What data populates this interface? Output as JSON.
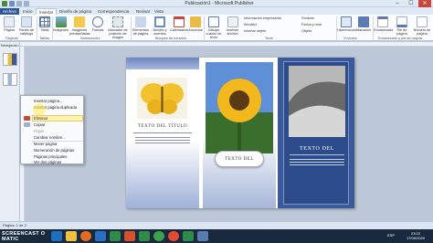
{
  "window": {
    "title": "Publicación1 - Microsoft Publisher",
    "minimize": "–",
    "maximize": "☐",
    "close": "✕"
  },
  "tabs": [
    "Archivo",
    "Inicio",
    "Insertar",
    "Diseño de página",
    "Correspondencia",
    "Revisar",
    "Vista"
  ],
  "ribbon": {
    "buttons": [
      {
        "label": "Página"
      },
      {
        "label": "Partes de catálogo"
      },
      {
        "label": "Tabla"
      },
      {
        "label": "Imágenes"
      },
      {
        "label": "Imágenes prediseñadas"
      },
      {
        "label": "Formas"
      },
      {
        "label": "Marcador de posición de imagen"
      },
      {
        "label": "Elementos de página"
      },
      {
        "label": "Bordes y acentos"
      },
      {
        "label": "Calendarios"
      },
      {
        "label": "Anuncios"
      },
      {
        "label": "Dibujar cuadro de texto"
      },
      {
        "label": "Insertar archivo"
      },
      {
        "label": "Hipervínculo"
      },
      {
        "label": "Marcador"
      },
      {
        "label": "Encabezado"
      },
      {
        "label": "Pie de página"
      },
      {
        "label": "Número de página"
      }
    ],
    "small": [
      "Información empresarial",
      "WordArt",
      "Insertar objeto",
      "Símbolo",
      "Fecha y hora",
      "Objeto"
    ],
    "groups": [
      "Páginas",
      "Tablas",
      "Ilustraciones",
      "Bloques de creación",
      "Texto",
      "Vínculos",
      "Encabezado y pie de página"
    ]
  },
  "pane": {
    "title": "Navegación de página"
  },
  "context_menu": {
    "items": [
      {
        "label": "Insertar página...",
        "enabled": true
      },
      {
        "label": "Insertar página duplicada",
        "enabled": true
      },
      {
        "label": "Eliminar",
        "enabled": true
      },
      {
        "label": "Copiar",
        "enabled": true
      },
      {
        "label": "Pegar",
        "enabled": false
      },
      {
        "label": "Cambiar nombre...",
        "enabled": true
      },
      {
        "label": "Mover página",
        "enabled": true
      },
      {
        "label": "Numeración de páginas",
        "enabled": true
      },
      {
        "label": "Páginas principales",
        "enabled": true
      },
      {
        "label": "Ver dos páginas",
        "enabled": true
      }
    ]
  },
  "document": {
    "panel1_title": "TEXTO DEL TÍTULO",
    "panel2_label": "TEXTO DEL",
    "panel3_title": "TEXTO DEL"
  },
  "statusbar": {
    "left": "Página: 1 de 2"
  },
  "taskbar": {
    "watermark": "SCREENCAST O MATIC",
    "language": "ESP",
    "time": "23:22",
    "date": "17/06/2020"
  },
  "colors": {
    "file_tab": "#2b5797",
    "panel_blue": "#3c5a99",
    "highlight": "#fff3b0"
  }
}
